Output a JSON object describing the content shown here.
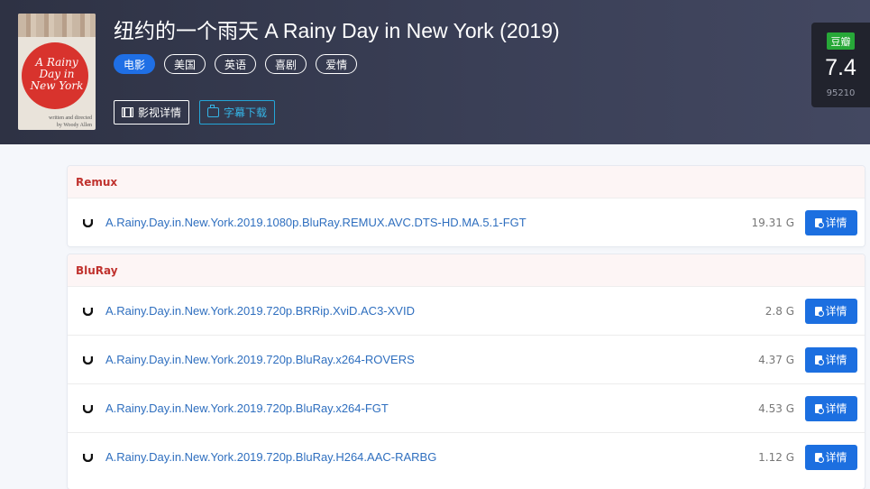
{
  "movie": {
    "title": "纽约的一个雨天 A Rainy Day in New York (2019)",
    "poster_title": "A Rainy\nDay in\nNew York",
    "poster_credit": "written and directed by\nWoody Allen",
    "tags": [
      "电影",
      "美国",
      "英语",
      "喜剧",
      "爱情"
    ],
    "actions": {
      "details_label": "影视详情",
      "subtitles_label": "字幕下载"
    }
  },
  "rating": {
    "source": "豆瓣",
    "score": "7.4",
    "votes": "95210"
  },
  "groups": [
    {
      "heading": "Remux",
      "items": [
        {
          "name": "A.Rainy.Day.in.New.York.2019.1080p.BluRay.REMUX.AVC.DTS-HD.MA.5.1-FGT",
          "size": "19.31 G",
          "action": "详情"
        }
      ]
    },
    {
      "heading": "BluRay",
      "items": [
        {
          "name": "A.Rainy.Day.in.New.York.2019.720p.BRRip.XviD.AC3-XVID",
          "size": "2.8 G",
          "action": "详情"
        },
        {
          "name": "A.Rainy.Day.in.New.York.2019.720p.BluRay.x264-ROVERS",
          "size": "4.37 G",
          "action": "详情"
        },
        {
          "name": "A.Rainy.Day.in.New.York.2019.720p.BluRay.x264-FGT",
          "size": "4.53 G",
          "action": "详情"
        },
        {
          "name": "A.Rainy.Day.in.New.York.2019.720p.BluRay.H264.AAC-RARBG",
          "size": "1.12 G",
          "action": "详情"
        }
      ]
    }
  ],
  "colors": {
    "accent": "#1f6fe5",
    "heading": "#c0322e",
    "link": "#2f6fbf",
    "douban": "#27a838"
  }
}
